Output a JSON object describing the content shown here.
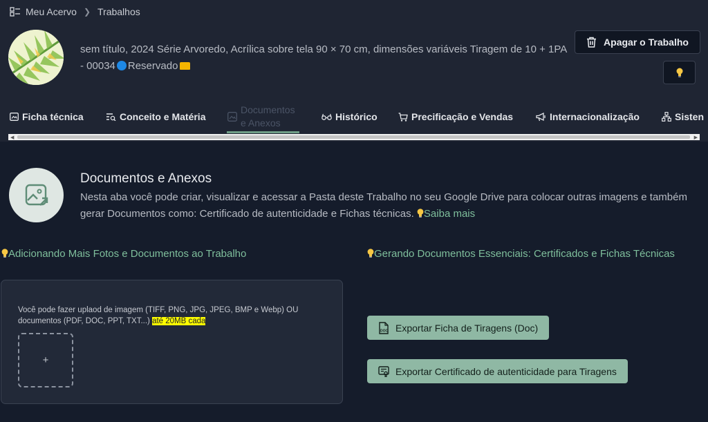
{
  "breadcrumb": {
    "root": "Meu Acervo",
    "current": "Trabalhos"
  },
  "artwork": {
    "title_main": "sem título, 2024 Série Arvoredo, Acrílica sobre tela 90 × 70 cm, dimensões variáveis Tiragem de 10 + 1PA - 00034",
    "status": "Reservado"
  },
  "actions": {
    "delete_label": "Apagar o Trabalho"
  },
  "tabs": [
    {
      "label": "Ficha técnica",
      "icon": "image-card-icon"
    },
    {
      "label": "Conceito e Matéria",
      "icon": "text-search-icon"
    },
    {
      "label": "Documentos e Anexos",
      "icon": "image-icon",
      "active": true
    },
    {
      "label": "Histórico",
      "icon": "glasses-icon"
    },
    {
      "label": "Precificação e Vendas",
      "icon": "cart-icon"
    },
    {
      "label": "Internacionalização",
      "icon": "megaphone-icon"
    },
    {
      "label": "Sisten",
      "icon": "network-icon"
    }
  ],
  "section": {
    "title": "Documentos e Anexos",
    "description": "Nesta aba você pode criar, visualizar e acessar a Pasta deste Trabalho no seu Google Drive para colocar outras imagens e também gerar Documentos como: Certificado de autenticidade e Fichas técnicas.",
    "help_link": "Saiba mais"
  },
  "left_column": {
    "heading": "Adicionando Mais Fotos e Documentos ao Trabalho",
    "upload_text": "Você pode fazer uplaod de imagem (TIFF, PNG, JPG, JPEG, BMP e Webp) OU documentos (PDF, DOC, PPT, TXT...)",
    "upload_limit": "até 20MB cada",
    "add_symbol": "+"
  },
  "right_column": {
    "heading": "Gerando Documentos Essenciais: Certificados e Fichas Técnicas",
    "export_ficha": "Exportar Ficha de Tiragens (Doc)",
    "export_certificado": "Exportar Certificado de autenticidade para Tiragens"
  },
  "colors": {
    "accent": "#7fbf9c",
    "button": "#8fb8a4",
    "background": "#151c2b",
    "header": "#1f2533",
    "status_dot": "#1e88e5"
  }
}
